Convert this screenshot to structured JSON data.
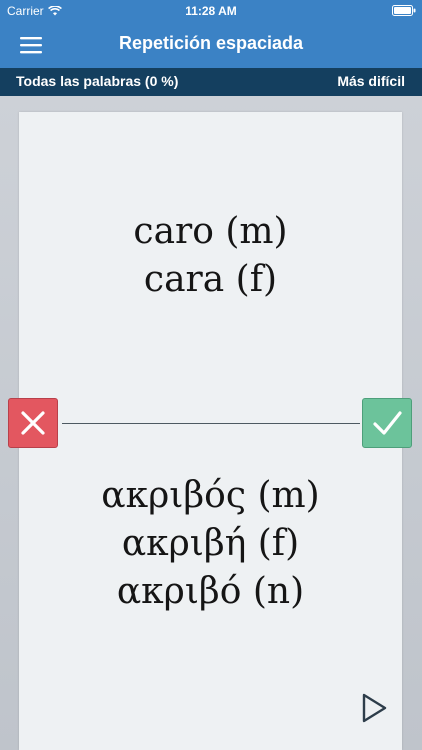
{
  "status_bar": {
    "carrier": "Carrier",
    "time": "11:28 AM",
    "icons": [
      "wifi-icon",
      "battery-icon"
    ]
  },
  "nav_bar": {
    "title": "Repetición espaciada",
    "menu_icon": "hamburger-menu-icon"
  },
  "info_bar": {
    "filter_label": "Todas las palabras (0 %)",
    "difficulty_label": "Más difícil"
  },
  "card": {
    "front_lines": [
      "caro (m)",
      "cara (f)"
    ],
    "back_lines": [
      "ακριβός (m)",
      "ακριβή (f)",
      "ακριβό (n)"
    ],
    "wrong_button_icon": "x-icon",
    "right_button_icon": "checkmark-icon",
    "next_icon": "play-next-icon"
  },
  "colors": {
    "nav_blue": "#3b82c5",
    "info_bar": "#143f5f",
    "wrong_red": "#e35760",
    "right_green": "#6cc39b"
  }
}
